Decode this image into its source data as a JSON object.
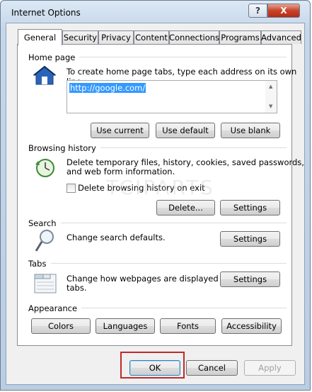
{
  "window": {
    "title": "Internet Options",
    "help_label": "?",
    "close_label": "X"
  },
  "tabs": [
    "General",
    "Security",
    "Privacy",
    "Content",
    "Connections",
    "Programs",
    "Advanced"
  ],
  "home_page": {
    "label": "Home page",
    "description": "To create home page tabs, type each address on its own line.",
    "value": "http://google.com/",
    "buttons": {
      "current": "Use current",
      "default": "Use default",
      "blank": "Use blank"
    }
  },
  "browsing_history": {
    "label": "Browsing history",
    "description_line1": "Delete temporary files, history, cookies, saved passwords,",
    "description_line2": "and web form information.",
    "checkbox_label": "Delete browsing history on exit",
    "checkbox_checked": false,
    "delete_label": "Delete...",
    "settings_label": "Settings"
  },
  "search": {
    "label": "Search",
    "description": "Change search defaults.",
    "settings_label": "Settings"
  },
  "tabs_section": {
    "label": "Tabs",
    "description_line1": "Change how webpages are displayed in",
    "description_line2": "tabs.",
    "settings_label": "Settings"
  },
  "appearance": {
    "label": "Appearance",
    "buttons": [
      "Colors",
      "Languages",
      "Fonts",
      "Accessibility"
    ]
  },
  "footer": {
    "ok": "OK",
    "cancel": "Cancel",
    "apply": "Apply"
  },
  "watermark": "TCIPARTS",
  "colors": {
    "highlight": "#c0292b",
    "selection": "#3399ff",
    "close": "#c7432a"
  }
}
